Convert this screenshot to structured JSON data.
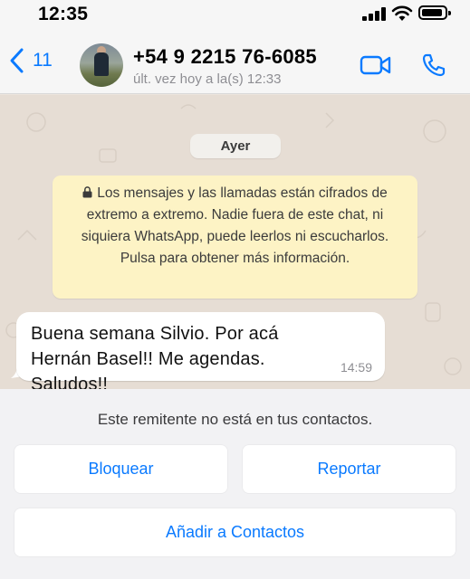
{
  "status_bar": {
    "time": "12:35"
  },
  "header": {
    "back_count": "11",
    "contact_name": "+54 9 2215 76-6085",
    "last_seen": "últ. vez hoy a la(s) 12:33",
    "icons": [
      "chevron-left-icon",
      "video-call-icon",
      "phone-call-icon"
    ],
    "accent_color": "#0a7aff"
  },
  "chat": {
    "date_label": "Ayer",
    "encryption_notice": "Los mensajes y las llamadas están cifrados de extremo a extremo. Nadie fuera de este chat, ni siquiera WhatsApp, puede leerlos ni escucharlos. Pulsa para obtener más información.",
    "message": {
      "text": "Buena semana Silvio. Por acá Hernán Basel!! Me agendas. Saludos!!",
      "time": "14:59"
    }
  },
  "sheet": {
    "note": "Este remitente no está en tus contactos.",
    "block_label": "Bloquear",
    "report_label": "Reportar",
    "add_label": "Añadir a Contactos"
  }
}
